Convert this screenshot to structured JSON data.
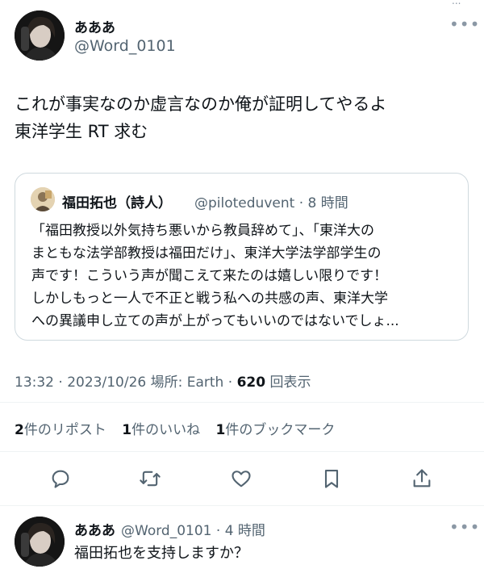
{
  "top_overflow": "...",
  "main_post": {
    "display_name": "あああ",
    "handle": "@Word_0101",
    "more": "•••",
    "text_lines": [
      "これが事実なのか虚言なのか俺が証明してやるよ",
      "東洋学生 RT 求む"
    ]
  },
  "quote": {
    "display_name": "福田拓也（詩人）",
    "handle": "@piloteduvent",
    "time": "8 時間",
    "body_lines": [
      "「福田教授以外気持ち悪いから教員辞めて」、「東洋大の",
      "まともな法学部教授は福田だけ」、東洋大学法学部学生の",
      "声です！こういう声が聞こえて来たのは嬉しい限りです！",
      "しかしもっと一人で不正と戦う私への共感の声、東洋大学",
      "への異議申し立ての声が上がってもいいのではないでしょ..."
    ]
  },
  "meta": {
    "time": "13:32",
    "date": "2023/10/26",
    "location": "場所: Earth",
    "views_count": "620",
    "views_label": "回表示"
  },
  "stats": {
    "reposts_count": "2",
    "reposts_label": "件のリポスト",
    "likes_count": "1",
    "likes_label": "件のいいね",
    "bookmarks_count": "1",
    "bookmarks_label": "件のブックマーク"
  },
  "actions": [
    "reply-icon",
    "repost-icon",
    "like-icon",
    "bookmark-icon",
    "share-icon"
  ],
  "reply_post": {
    "display_name": "あああ",
    "handle": "@Word_0101",
    "time": "4 時間",
    "more": "•••",
    "text": "福田拓也を支持しますか？"
  },
  "colors": {
    "text": "#0f1419",
    "secondary": "#536471",
    "border": "#cfd9de",
    "divider": "#eff3f4"
  }
}
